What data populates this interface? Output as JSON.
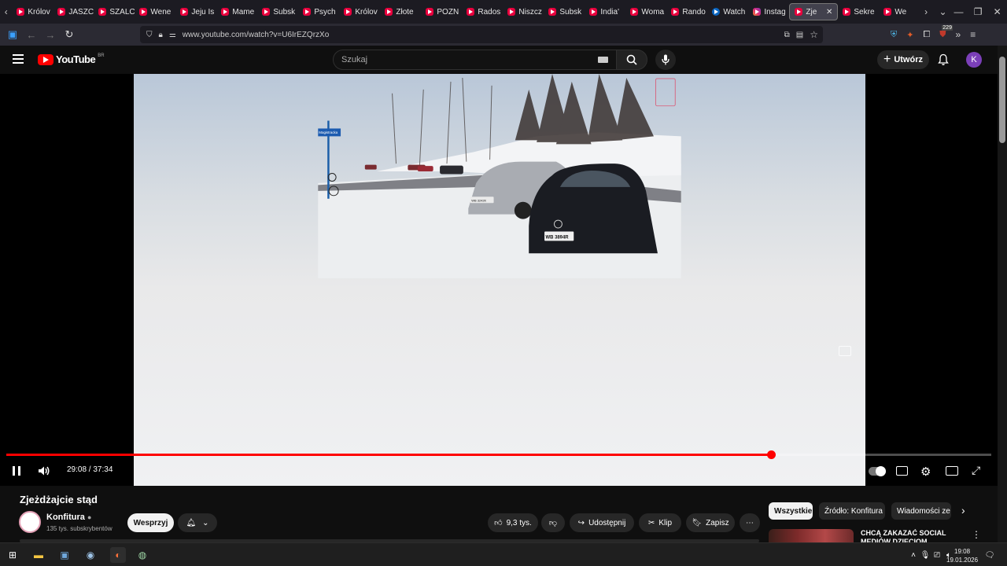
{
  "browser": {
    "tabs": [
      {
        "label": "Królov",
        "icon": "youtube-icon"
      },
      {
        "label": "JASZC",
        "icon": "youtube-icon"
      },
      {
        "label": "SZALC",
        "icon": "youtube-icon"
      },
      {
        "label": "Wene",
        "icon": "youtube-icon"
      },
      {
        "label": "Jeju Is",
        "icon": "youtube-icon"
      },
      {
        "label": "Mame",
        "icon": "youtube-icon"
      },
      {
        "label": "Subsk",
        "icon": "youtube-icon"
      },
      {
        "label": "Psych",
        "icon": "youtube-icon"
      },
      {
        "label": "Królov",
        "icon": "youtube-icon"
      },
      {
        "label": "Złote ",
        "icon": "youtube-icon"
      },
      {
        "label": "POZN",
        "icon": "youtube-icon"
      },
      {
        "label": "Rados",
        "icon": "youtube-icon"
      },
      {
        "label": "Niszcz",
        "icon": "youtube-icon"
      },
      {
        "label": "Subsk",
        "icon": "youtube-icon"
      },
      {
        "label": "India'",
        "icon": "youtube-icon"
      },
      {
        "label": "Woma",
        "icon": "youtube-icon"
      },
      {
        "label": "Rando",
        "icon": "youtube-icon"
      },
      {
        "label": "Watch",
        "icon": "messenger-icon"
      },
      {
        "label": "Instag",
        "icon": "instagram-icon"
      },
      {
        "label": "Zje",
        "icon": "youtube-icon",
        "active": true
      },
      {
        "label": "Sekre",
        "icon": "youtube-icon"
      },
      {
        "label": "We",
        "icon": "youtube-icon"
      }
    ],
    "url": "www.youtube.com/watch?v=U6IrEZQrzXo",
    "extension_badge": "229"
  },
  "youtube": {
    "logo_text": "YouTube",
    "country_code": "BR",
    "search_placeholder": "Szukaj",
    "create_label": "Utwórz",
    "avatar_letter": "K"
  },
  "player": {
    "time": "29:08 / 37:34",
    "progress_fraction": 0.776,
    "plate_front": "WB 3894R",
    "plate_silver": "WB 3242K",
    "street_sign": "Magistracka"
  },
  "video_info": {
    "title": "Zjeżdżajcie stąd",
    "channel": "Konfitura",
    "subscribers": "135 tys. subskrybentów",
    "support_label": "Wesprzyj",
    "likes": "9,3 tys.",
    "share_label": "Udostępnij",
    "clip_label": "Klip",
    "save_label": "Zapisz"
  },
  "chips": [
    "Wszystkie",
    "Źródło: Konfitura",
    "Wiadomości ze ś"
  ],
  "suggestion": {
    "title": "CHCĄ ZAKAZAĆ SOCIAL MEDIÓW DZIECIOM"
  },
  "taskbar": {
    "time": "19:08",
    "date": "19.01.2026"
  }
}
